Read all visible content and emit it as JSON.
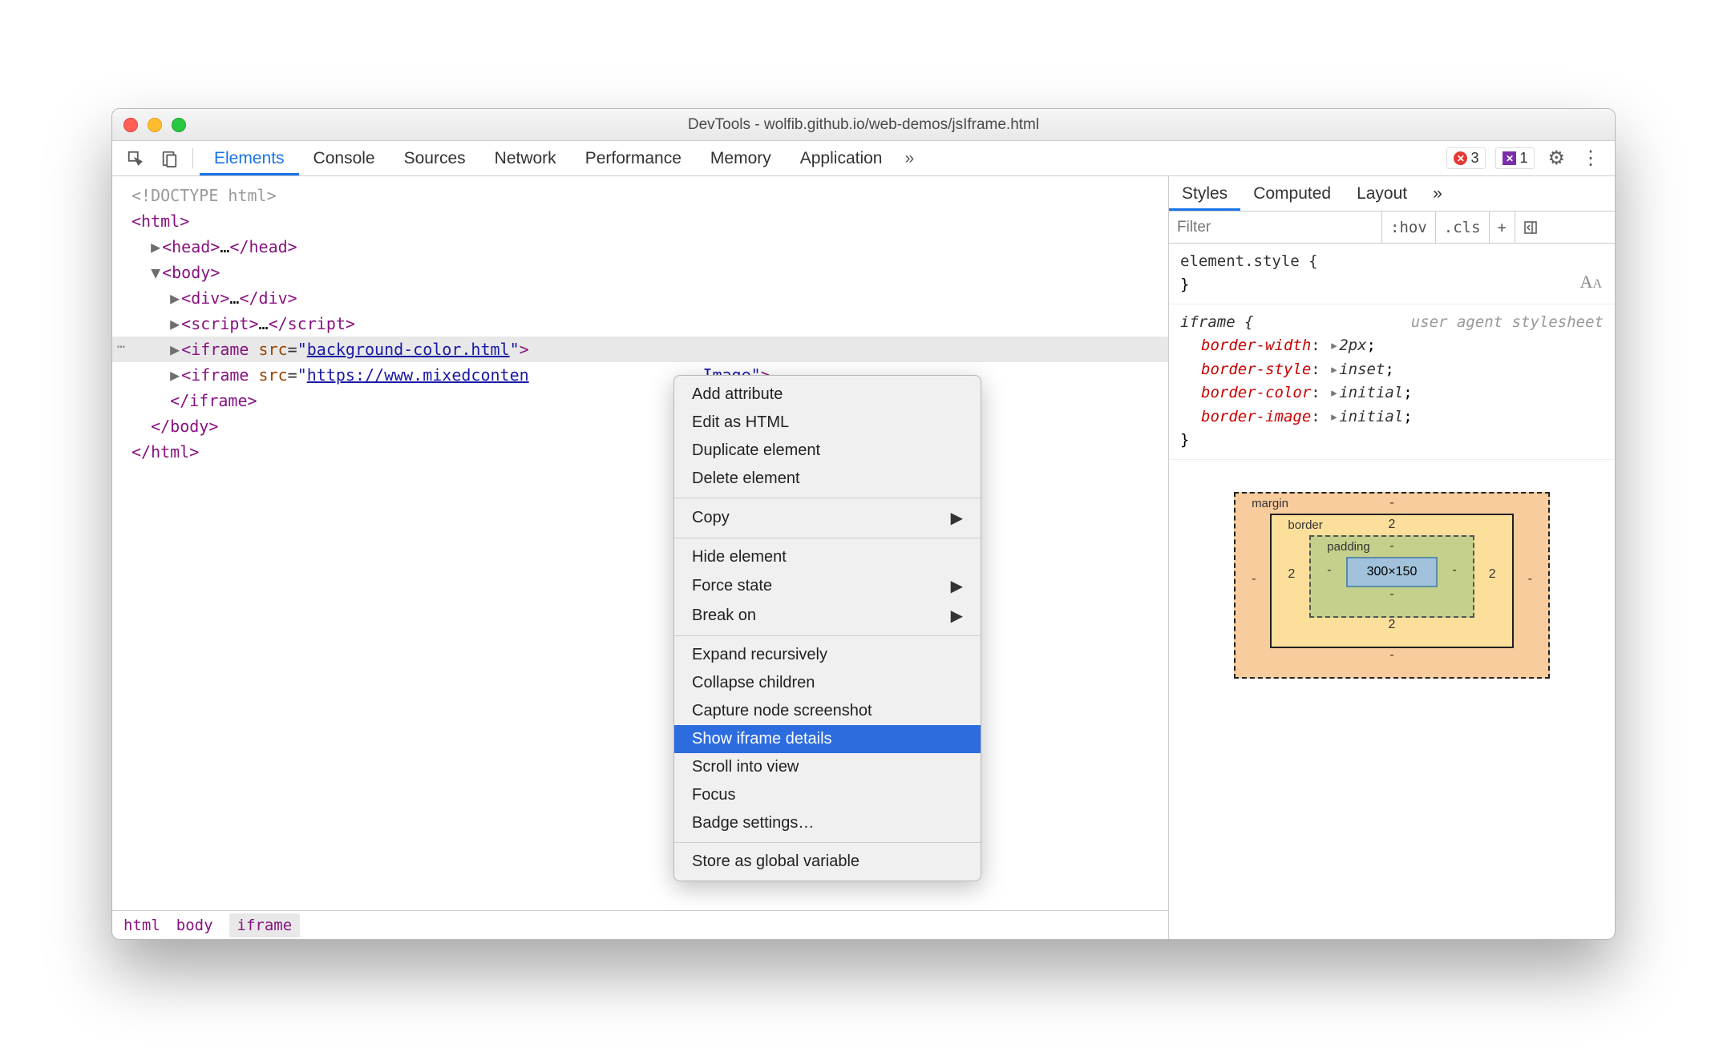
{
  "window_title": "DevTools - wolfib.github.io/web-demos/jsIframe.html",
  "toolbar_tabs": [
    "Elements",
    "Console",
    "Sources",
    "Network",
    "Performance",
    "Memory",
    "Application"
  ],
  "toolbar_active_tab": "Elements",
  "error_count": "3",
  "ext_count": "1",
  "dom": {
    "doctype": "<!DOCTYPE html>",
    "html_open": "html",
    "head_tag": "head",
    "body_tag": "body",
    "div_tag": "div",
    "script_tag": "script",
    "iframe_tag": "iframe",
    "src_attr": "src",
    "src1": "background-color.html",
    "src2_prefix": "https://www.mixedconten",
    "src2_suffix": "Image",
    "ellipsis": "…",
    "close_iframe": "</iframe>",
    "close_body": "</body>",
    "close_html": "</html>"
  },
  "breadcrumb": [
    "html",
    "body",
    "iframe"
  ],
  "context_menu": {
    "items1": [
      "Add attribute",
      "Edit as HTML",
      "Duplicate element",
      "Delete element"
    ],
    "copy": "Copy",
    "items2": [
      "Hide element"
    ],
    "force_state": "Force state",
    "break_on": "Break on",
    "items3": [
      "Expand recursively",
      "Collapse children",
      "Capture node screenshot"
    ],
    "selected": "Show iframe details",
    "items4": [
      "Scroll into view",
      "Focus",
      "Badge settings…"
    ],
    "items5": [
      "Store as global variable"
    ]
  },
  "styles_tabs": [
    "Styles",
    "Computed",
    "Layout"
  ],
  "styles_active": "Styles",
  "filter_placeholder": "Filter",
  "filter_btns": {
    "hov": ":hov",
    "cls": ".cls"
  },
  "rules": {
    "element_style_open": "element.style {",
    "element_style_close": "}",
    "iframe_open": "iframe {",
    "ua_comment": "user agent stylesheet",
    "p1_name": "border-width",
    "p1_val": "2px",
    "p2_name": "border-style",
    "p2_val": "inset",
    "p3_name": "border-color",
    "p3_val": "initial",
    "p4_name": "border-image",
    "p4_val": "initial",
    "close": "}"
  },
  "box_model": {
    "margin_label": "margin",
    "border_label": "border",
    "padding_label": "padding",
    "content": "300×150",
    "margin": {
      "top": "-",
      "right": "-",
      "bottom": "-",
      "left": "-"
    },
    "border": {
      "top": "2",
      "right": "2",
      "bottom": "2",
      "left": "2"
    },
    "padding": {
      "top": "-",
      "right": "-",
      "bottom": "-",
      "left": "-"
    }
  }
}
